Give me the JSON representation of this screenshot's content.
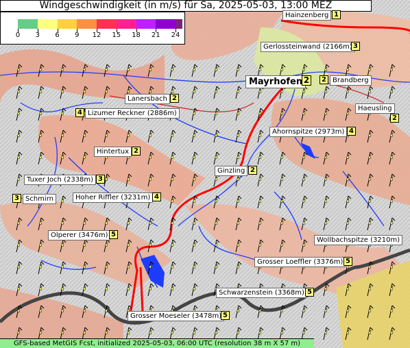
{
  "title": "Windgeschwindigkeit (in m/s) für Sa, 2025-05-03, 13:00 MEZ",
  "legend": {
    "stops": [
      "0",
      "3",
      "6",
      "9",
      "12",
      "15",
      "18",
      "21",
      "24"
    ],
    "colors": [
      "#66cc88",
      "#ffff80",
      "#ffd040",
      "#ff9040",
      "#ff3050",
      "#ff2090",
      "#c020ff",
      "#9000d0",
      "#802080"
    ]
  },
  "places": [
    {
      "name": "Hainzenberg",
      "speed": "1"
    },
    {
      "name": "Gerlossteinwand (2166m)",
      "speed": "3"
    },
    {
      "name": "Mayrhofen",
      "speed": "2"
    },
    {
      "name": "Brandberg",
      "speed": "2"
    },
    {
      "name": "Lanersbach",
      "speed": "2"
    },
    {
      "name": "Haeusling",
      "speed": "2"
    },
    {
      "name": "Lizumer Reckner (2886m)",
      "speed": "4"
    },
    {
      "name": "Ahornspitze (2973m)",
      "speed": "4"
    },
    {
      "name": "Hintertux",
      "speed": "2"
    },
    {
      "name": "Ginzling",
      "speed": "2"
    },
    {
      "name": "Tuxer Joch (2338m)",
      "speed": "3"
    },
    {
      "name": "Schmirn",
      "speed": "3"
    },
    {
      "name": "Hoher Riffler (3231m)",
      "speed": "4"
    },
    {
      "name": "Olperer (3476m)",
      "speed": "5"
    },
    {
      "name": "Wollbachspitze (3210m)",
      "speed": ""
    },
    {
      "name": "Grosser Loeffler (3376m)",
      "speed": "5"
    },
    {
      "name": "Schwarzenstein (3368m)",
      "speed": "5"
    },
    {
      "name": "Grosser Moeseler (3478m)",
      "speed": "5"
    }
  ],
  "footer": "GFS-based MetGIS Fcst, initialized 2025-05-03, 06:00 UTC  (resolution 38 m X 57 m)"
}
